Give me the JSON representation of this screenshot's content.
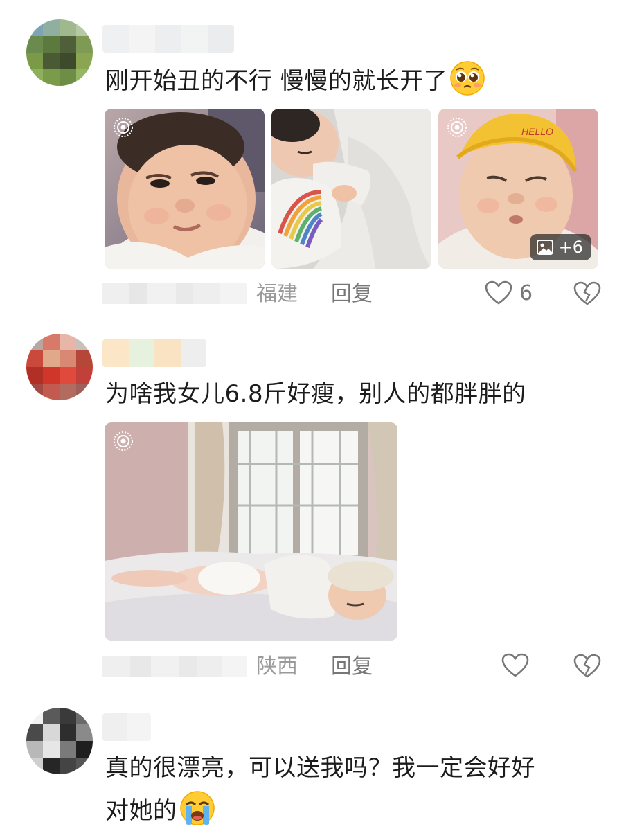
{
  "comments": [
    {
      "username": "",
      "text": "刚开始丑的不行 慢慢的就长开了",
      "emoji": "pleading-face-emoji",
      "images": [
        {
          "subject": "baby-face-photo-1",
          "live": true
        },
        {
          "subject": "baby-sleeping-photo-2",
          "live": false
        },
        {
          "subject": "baby-yellow-hat-photo-3",
          "live": true,
          "more_count": "+6"
        }
      ],
      "time": "",
      "location": "福建",
      "reply_label": "回复",
      "like_count": "6"
    },
    {
      "username": "",
      "text": "为啥我女儿6.8斤好瘦，别人的都胖胖的",
      "images": [
        {
          "subject": "baby-on-bed-photo",
          "live": true
        }
      ],
      "time": "",
      "location": "陕西",
      "reply_label": "回复",
      "like_count": ""
    },
    {
      "username": "",
      "text_line1": "真的很漂亮，可以送我吗？我一定会好好",
      "text_line2": "对她的",
      "emoji": "loudly-crying-face-emoji"
    }
  ],
  "colors": {
    "text": "#1c1c1c",
    "meta": "#9a9a9a",
    "icon": "#777777"
  }
}
